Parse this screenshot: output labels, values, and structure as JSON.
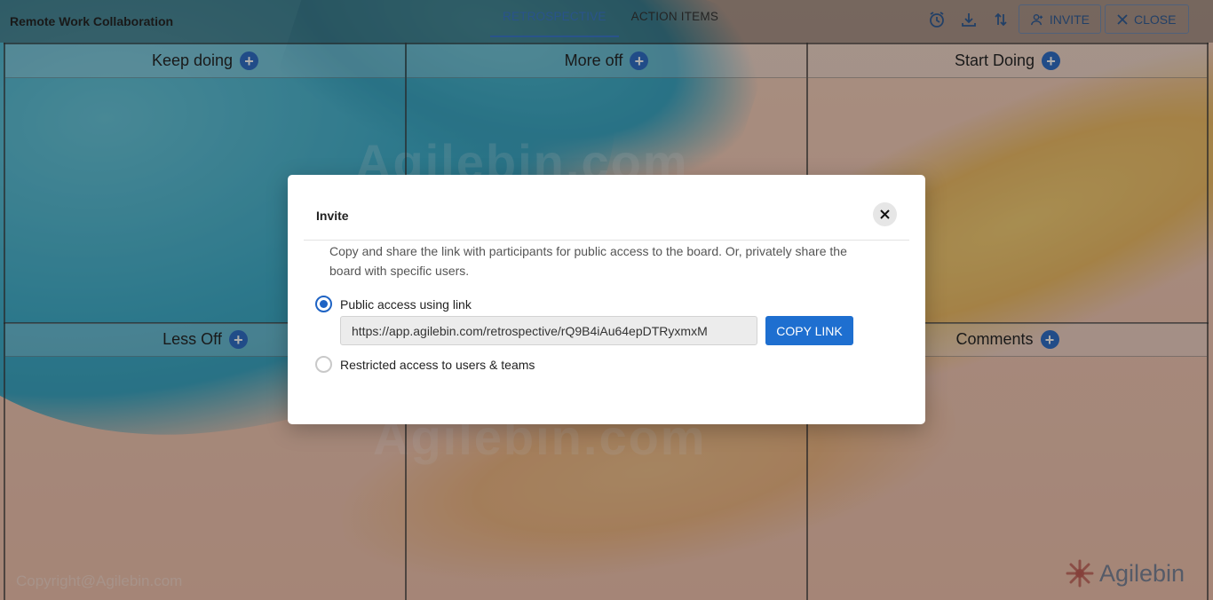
{
  "header": {
    "title": "Remote Work Collaboration",
    "tabs": [
      {
        "label": "RETROSPECTIVE",
        "active": true
      },
      {
        "label": "ACTION ITEMS",
        "active": false
      }
    ],
    "icons": [
      "alarm-clock-icon",
      "download-icon",
      "sort-icon"
    ],
    "invite_label": "INVITE",
    "close_label": "CLOSE"
  },
  "board": {
    "columns": [
      {
        "label": "Keep doing"
      },
      {
        "label": "More off"
      },
      {
        "label": "Start Doing"
      },
      {
        "label": "Less Off"
      },
      {
        "label": "Comments"
      }
    ],
    "watermark": "Agilebin.com",
    "copyright": "Copyright@Agilebin.com",
    "brand": "Agilebin"
  },
  "modal": {
    "title": "Invite",
    "description": "Copy and share the link with participants for public access to the board. Or, privately share the board with specific users.",
    "public_option_label": "Public access using link",
    "link_value": "https://app.agilebin.com/retrospective/rQ9B4iAu64epDTRyxmxM",
    "copy_button_label": "COPY LINK",
    "restricted_option_label": "Restricted access to users & teams",
    "selected_option": "public"
  },
  "colors": {
    "accent": "#1e63c4",
    "tab_active": "#2a6fc9",
    "copy_button": "#1e6fd0"
  }
}
